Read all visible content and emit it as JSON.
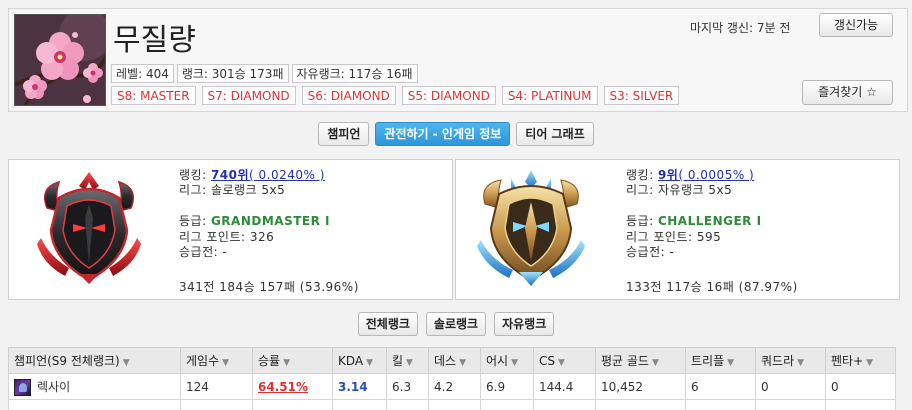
{
  "summoner": {
    "name": "무질량",
    "level_text": "레벨: 404",
    "rank_text": "랭크: 301승 173패",
    "flex_text": "자유랭크: 117승 16패"
  },
  "seasons": [
    "S8: MASTER",
    "S7: DIAMOND",
    "S6: DIAMOND",
    "S5: DIAMOND",
    "S4: PLATINUM",
    "S3: SILVER"
  ],
  "update": {
    "last_update": "마지막 갱신: 7분 전",
    "refresh_label": "갱신가능",
    "favorite_label": "즐겨찾기 ☆"
  },
  "tabs": [
    "챔피언",
    "관전하기 - 인게임 정보",
    "티어 그래프"
  ],
  "solo": {
    "rank_label": "랭킹: ",
    "rank_value": "740위",
    "rank_pct": "( 0.0240% )",
    "league": "리그: 솔로랭크 5x5",
    "tier_label": "등급: ",
    "tier": "GRANDMASTER I",
    "lp": "리그 포인트: 326",
    "promo": "승급전: -",
    "record": "341전 184승 157패 (53.96%)"
  },
  "flex": {
    "rank_label": "랭킹: ",
    "rank_value": "9위",
    "rank_pct": "( 0.0005% )",
    "league": "리그: 자유랭크 5x5",
    "tier_label": "등급: ",
    "tier": "CHALLENGER I",
    "lp": "리그 포인트: 595",
    "promo": "승급전: -",
    "record": "133전 117승 16패 (87.97%)"
  },
  "filters": [
    "전체랭크",
    "솔로랭크",
    "자유랭크"
  ],
  "table": {
    "headers": [
      "챔피언(S9 전체랭크)",
      "게임수",
      "승률",
      "KDA",
      "킬",
      "데스",
      "어시",
      "CS",
      "평균 골드",
      "트리플",
      "쿼드라",
      "펜타+"
    ],
    "rows": [
      {
        "champion": "렉사이",
        "games": "124",
        "winrate": "64.51%",
        "kda": "3.14",
        "kills": "6.3",
        "deaths": "4.2",
        "assists": "6.9",
        "cs": "144.4",
        "gold": "10,452",
        "triple": "6",
        "quadra": "0",
        "penta": "0"
      }
    ]
  },
  "icons": {
    "avatar": "cherry-blossom-avatar",
    "solo_emblem": "grandmaster-emblem-icon",
    "flex_emblem": "challenger-emblem-icon",
    "champion": "rek-sai-champion-icon",
    "sort": "sort-arrow-icon"
  },
  "colors": {
    "season_text": "#dd3333",
    "tier_text": "#2e8b3a",
    "rank_link": "#2233aa",
    "active_tab": "#2c96d8",
    "winrate": "#dd3333",
    "kda": "#2b4fb8"
  }
}
